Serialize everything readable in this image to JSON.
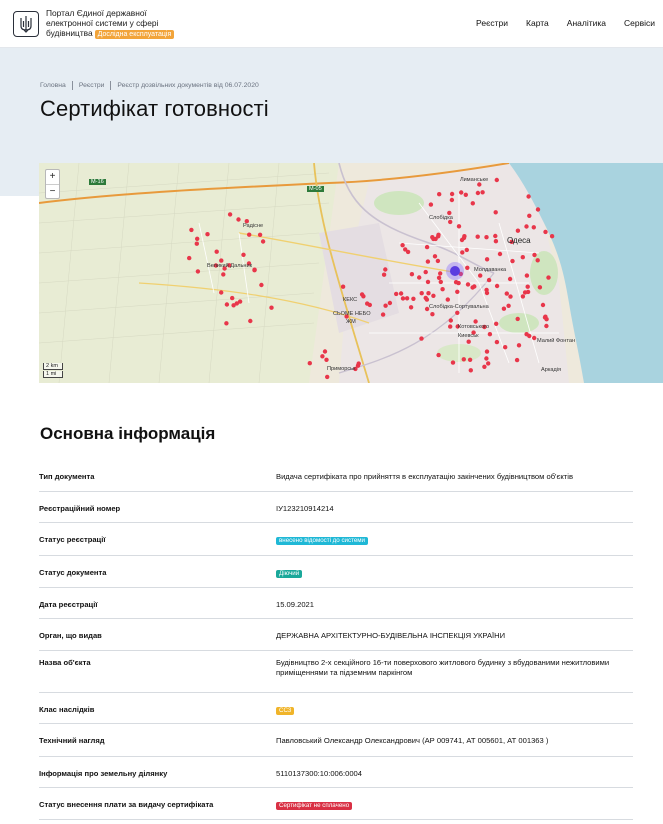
{
  "header": {
    "brand_line1": "Портал Єдиної державної",
    "brand_line2": "електронної системи у сфері",
    "brand_line3": "будівництва",
    "beta_badge": "Дослідна експлуатація",
    "nav": [
      "Реєстри",
      "Карта",
      "Аналітика",
      "Сервіси"
    ],
    "colors": {
      "beta_badge_bg": "#f2a43a"
    }
  },
  "breadcrumb": [
    "Головна",
    "Реєстри",
    "Реєстр дозвільних документів від 06.07.2020"
  ],
  "page_title": "Сертифікат готовності",
  "map": {
    "zoom_in": "+",
    "zoom_out": "−",
    "scale_km": "2 km",
    "scale_mi": "1 mi",
    "labels": {
      "odesa": "Одеса",
      "lymanske": "Лиманське",
      "slobidka": "Слобідка",
      "moldavanka": "Молдаванка",
      "sortyrovochna": "Слобідка-Сортувальна",
      "kotovskoho": "Котовського",
      "kievskyi": "Киевськ",
      "fontan": "Малий Фонтан",
      "arkadia": "Аркадія",
      "radisne": "Радісне",
      "velykyi_dalnyk": "Великий Дальник",
      "keks": "КЕКС",
      "syome_nebo": "СЬОМЕ НЕБО",
      "zhm": "ЖМ",
      "m16": "М-16",
      "m05": "М-05",
      "pryvokzalna": "Приморськ",
      "dalnyk": "Дальник"
    }
  },
  "section_title": "Основна інформація",
  "info_rows": [
    {
      "key": "Тип документа",
      "value": "Видача сертифіката про прийняття в експлуатацію закінчених будівництвом об'єктів"
    },
    {
      "key": "Реєстраційний номер",
      "value": "ІУ123210914214"
    },
    {
      "key": "Статус реєстрації",
      "value": "внесено відомості до системи",
      "pill": "cyan"
    },
    {
      "key": "Статус документа",
      "value": "Діючий",
      "pill": "teal"
    },
    {
      "key": "Дата реєстрації",
      "value": "15.09.2021"
    },
    {
      "key": "Орган, що видав",
      "value": "ДЕРЖАВНА АРХІТЕКТУРНО-БУДІВЕЛЬНА ІНСПЕКЦІЯ УКРАЇНИ"
    },
    {
      "key": "Назва об'єкта",
      "value": "Будівництво 2-х секційного 16-ти поверхового житлового будинку з вбудованими нежитловими приміщеннями та підземним паркінгом"
    },
    {
      "key": "Клас наслідків",
      "value": "СС3",
      "pill": "amber"
    },
    {
      "key": "Технічний нагляд",
      "value": "Павловський Олександр Олександрович (АР 009741, АТ 005601, АТ 001363 )"
    },
    {
      "key": "Інформація про земельну ділянку",
      "value": "5110137300:10:006:0004"
    },
    {
      "key": "Статус внесення плати за видачу сертифіката",
      "value": "Сертифікат не сплачено",
      "pill": "red"
    }
  ],
  "pill_colors": {
    "cyan": "#1fb8d6",
    "teal": "#1aa89a",
    "amber": "#f0b429",
    "red": "#d93044"
  }
}
